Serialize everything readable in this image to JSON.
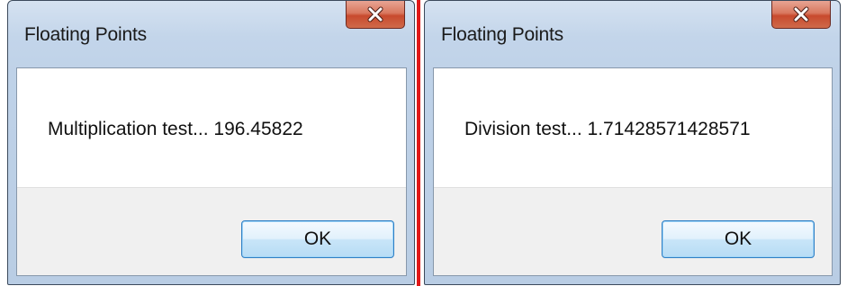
{
  "dialogs": [
    {
      "title": "Floating Points",
      "message": "Multiplication test... 196.45822",
      "ok_label": "OK"
    },
    {
      "title": "Floating Points",
      "message": "Division test... 1.71428571428571",
      "ok_label": "OK"
    }
  ],
  "colors": {
    "divider": "#e01818",
    "close_button": "#c84a2e",
    "ok_button_border": "#2f7fc4"
  },
  "icons": {
    "close": "close-icon"
  }
}
